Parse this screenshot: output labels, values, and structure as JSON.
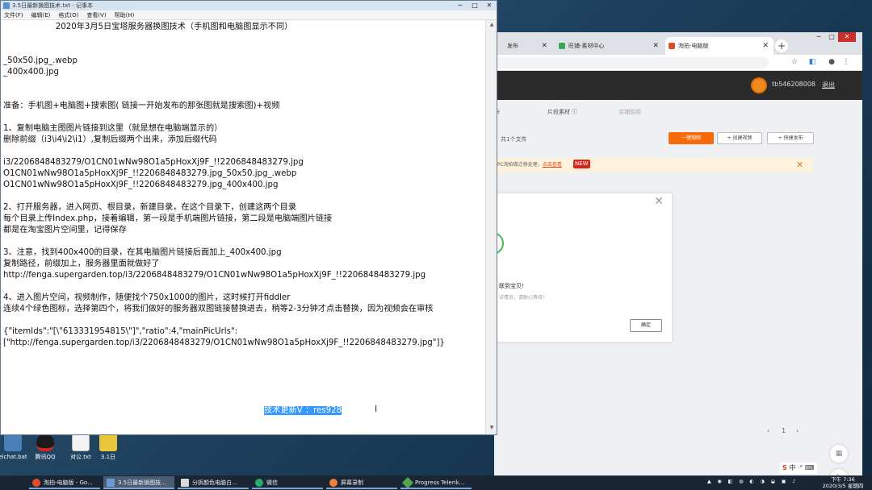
{
  "browser": {
    "tabs": [
      {
        "label": "发布",
        "fav_color": "#e04a2c"
      },
      {
        "label": "旺铺-素材中心",
        "fav_color": "#3ba55d"
      },
      {
        "label": "淘拍-电脑版",
        "fav_color": "#e04a2c"
      }
    ],
    "user": "tb546208008",
    "logout": "退出",
    "section_tabs": [
      "布",
      "片段素材 ⓘ",
      "店铺视频"
    ],
    "file_count": "共1个文件",
    "btn_onekey": "一键视频",
    "btn_create": "+ 创建视频",
    "btn_quick": "+ 快捷发布",
    "notice_text": "PC淘拍做迁移处理，",
    "notice_link": "点击查看",
    "new_badge": "NEW",
    "modal_title": "联到宝贝！",
    "modal_sub": "详情页，请耐心等待！",
    "modal_ok": "确定",
    "pager_page": "1"
  },
  "notepad": {
    "title": "3.5日最新换图技术.txt - 记事本",
    "menu": [
      "文件(F)",
      "编辑(E)",
      "格式(O)",
      "查看(V)",
      "帮助(H)"
    ],
    "lines": [
      "                    2020年3月5日宝塔服务器换图技术（手机图和电脑图显示不同）",
      "",
      "",
      "_50x50.jpg_.webp",
      "_400x400.jpg",
      "",
      "",
      "准备：手机图+电脑图+搜索图( 链接一开始发布的那张图就是搜索图)+视频",
      "",
      "1、复制电脑主图图片链接到这里（就是想在电脑端显示的）",
      "删除前缀（i3\\i4\\i2\\i1）,复制后缀两个出来，添加后缀代码",
      "",
      "i3/2206848483279/O1CN01wNw98O1a5pHoxXj9F_!!2206848483279.jpg",
      "O1CN01wNw98O1a5pHoxXj9F_!!2206848483279.jpg_50x50.jpg_.webp",
      "O1CN01wNw98O1a5pHoxXj9F_!!2206848483279.jpg_400x400.jpg",
      "",
      "2、打开服务器，进入网页、根目录，新建目录，在这个目录下，创建这两个目录",
      "每个目录上传Index.php，接着编辑，第一段是手机端图片链接，第二段是电脑端图片链接",
      "都是在淘宝图片空间里，记得保存",
      "",
      "3、注意，找到400x400的目录，在其电脑图片链接后面加上_400x400.jpg",
      "复制路径，前缀加上，服务器里面就做好了",
      "http://fenga.supergarden.top/i3/2206848483279/O1CN01wNw98O1a5pHoxXj9F_!!2206848483279.jpg",
      "",
      "4、进入图片空间，视频制作，随便找个750x1000的图片，这时候打开fiddler",
      "连续4个绿色图标，选择第四个，将我们做好的服务器双图链接替换进去，稍等2-3分钟才点击替换，因为视频会在审核",
      "",
      "{\"itemIds\":\"[\\\"613331954815\\\"]\",\"ratio\":4,\"mainPicUrls\":",
      "[\"http://fenga.supergarden.top/i3/2206848483279/O1CN01wNw98O1a5pHoxXj9F_!!2206848483279.jpg\"]}",
      "",
      "",
      "",
      "",
      "",
      "",
      ""
    ],
    "highlight_text": "技术更新V ：res928"
  },
  "desktop_icons": [
    {
      "label": "eichat.bat",
      "color": "#4a7fb5"
    },
    {
      "label": "腾讯QQ",
      "color": "#1b1b1b"
    },
    {
      "label": "对公.txt",
      "color": "#f4f4f4"
    },
    {
      "label": "3.1日",
      "color": "#e8c53a"
    }
  ],
  "taskbar": {
    "items": [
      {
        "label": "淘拍-电脑版 - Go...",
        "color": "#e44d26"
      },
      {
        "label": "3.5日最新换图技...",
        "color": "#6b9bd1"
      },
      {
        "label": "分拆颜色电脑白...",
        "color": "#d9d9d9"
      },
      {
        "label": "微信",
        "color": "#2aae67"
      },
      {
        "label": "屏幕录制",
        "color": "#f0803c"
      },
      {
        "label": "Progress Telerik...",
        "color": "#53a551"
      }
    ],
    "time": "下午 7:36",
    "date": "2020/3/5 星期四",
    "ime": "中"
  }
}
